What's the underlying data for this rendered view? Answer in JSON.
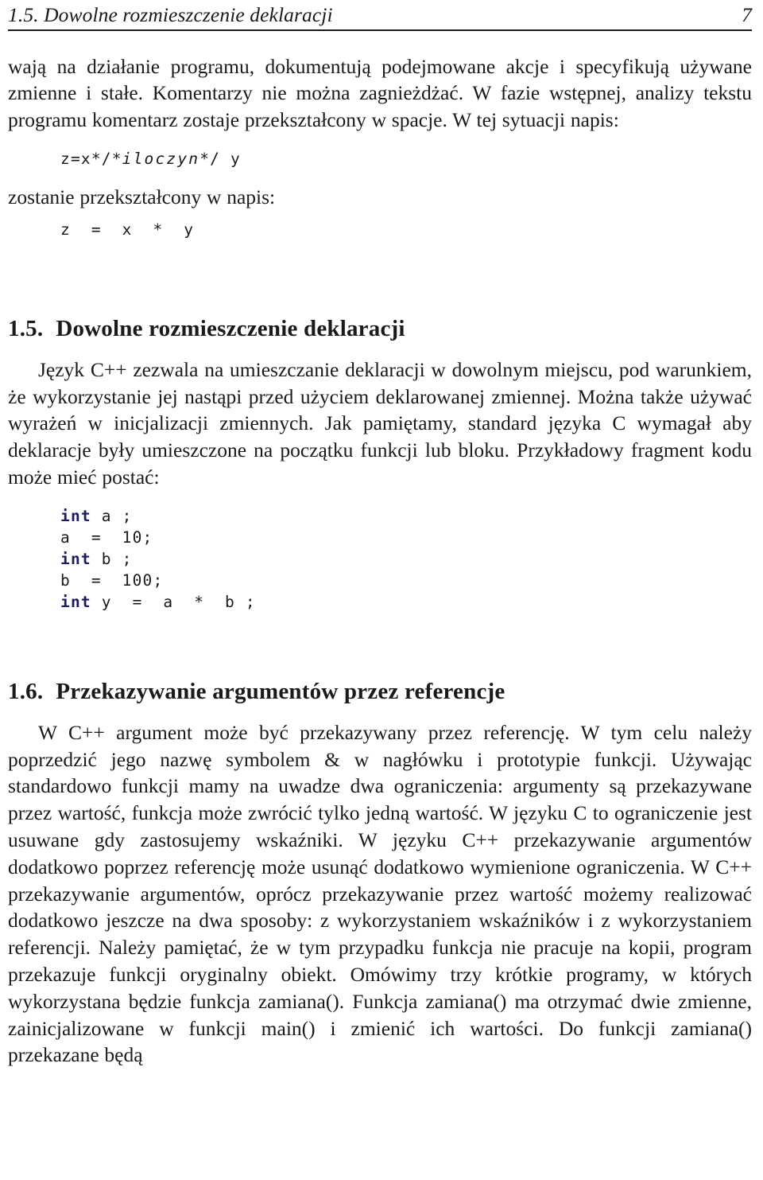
{
  "document": {
    "language": "pl",
    "running_header": {
      "title": "1.5. Dowolne rozmieszczenie deklaracji",
      "page_number": "7"
    },
    "continued_paragraph": "wają na działanie programu, dokumentują podejmowane akcje i specyfikują używane zmienne i stałe. Komentarzy nie można zagnieżdżać. W fazie wstępnej, analizy tekstu programu komentarz zostaje przekształcony w spacje. W tej sytuacji napis:",
    "code_block_1": {
      "prefix": "z=x*/*",
      "italic": "iloczyn",
      "suffix": "*/ y"
    },
    "bridge_text": "zostanie przekształcony w napis:",
    "code_block_2": "z  =  x  *  y",
    "section_1_5": {
      "number": "1.5.",
      "title": "Dowolne rozmieszczenie deklaracji",
      "paragraph": "Język C++ zezwala na umieszczanie deklaracji w dowolnym miejscu, pod warunkiem, że wykorzystanie jej nastąpi przed użyciem deklarowanej zmiennej. Można także używać wyrażeń w inicjalizacji zmiennych. Jak pamiętamy, standard języka C wymagał aby deklaracje były umieszczone na początku funkcji lub bloku. Przykładowy fragment kodu może mieć postać:",
      "code_listing": [
        {
          "keyword": "int",
          "rest": " a ;"
        },
        {
          "keyword": "",
          "rest": "a  =  10;"
        },
        {
          "keyword": "int",
          "rest": " b ;"
        },
        {
          "keyword": "",
          "rest": "b  =  100;"
        },
        {
          "keyword": "int",
          "rest": " y  =  a  *  b ;"
        }
      ],
      "keyword_color": "#1c1c5c"
    },
    "section_1_6": {
      "number": "1.6.",
      "title": "Przekazywanie argumentów przez referencje",
      "paragraph": "W C++ argument może być przekazywany przez referencję. W tym celu należy poprzedzić jego nazwę symbolem & w nagłówku i prototypie funkcji. Używając standardowo funkcji mamy na uwadze dwa ograniczenia: argumenty są przekazywane przez wartość, funkcja może zwrócić tylko jedną wartość. W języku C to ograniczenie jest usuwane gdy zastosujemy wskaźniki. W języku C++ przekazywanie argumentów dodatkowo poprzez referencję może usunąć dodatkowo wymienione ograniczenia. W C++ przekazywanie argumentów, oprócz przekazywanie przez wartość możemy realizować dodatkowo jeszcze na dwa sposoby: z wykorzystaniem wskaźników i z wykorzystaniem referencji. Należy pamiętać, że w tym przypadku funkcja nie pracuje na kopii, program przekazuje funkcji oryginalny obiekt. Omówimy trzy krótkie programy, w których wykorzystana będzie funkcja zamiana(). Funkcja zamiana() ma otrzymać dwie zmienne, zainicjalizowane w funkcji main() i zmienić ich wartości. Do funkcji zamiana() przekazane będą"
    }
  }
}
